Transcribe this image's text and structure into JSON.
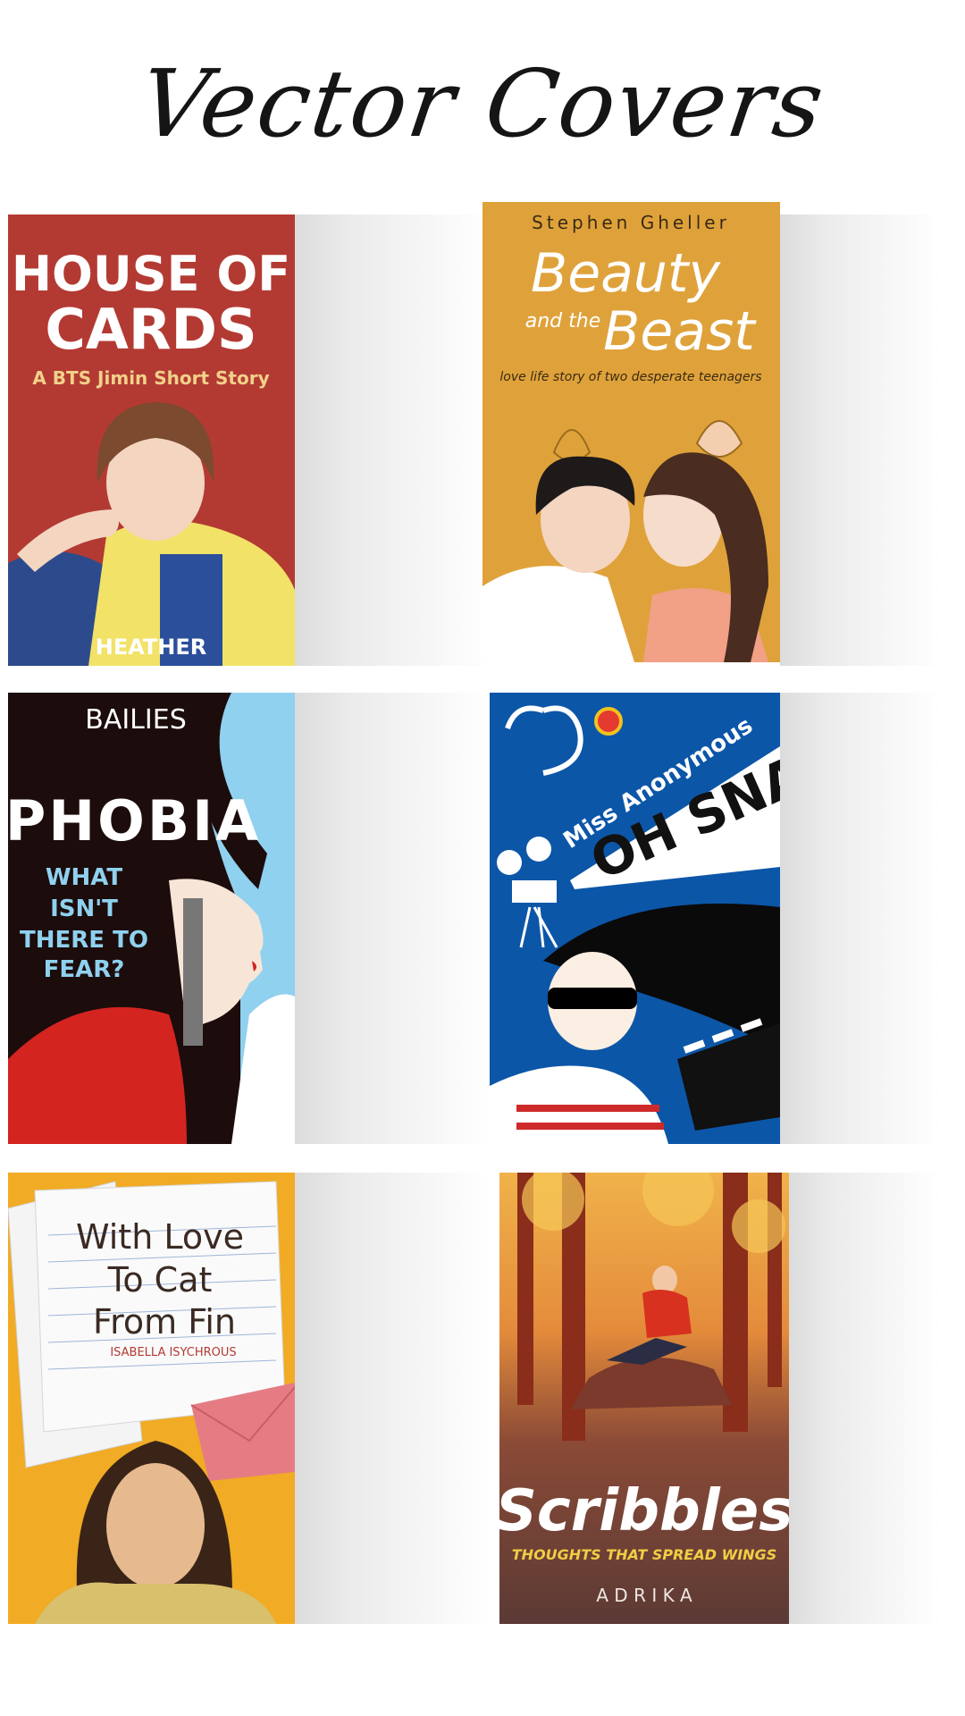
{
  "page": {
    "title": "Vector Covers"
  },
  "covers": [
    {
      "title_line1": "HOUSE OF",
      "title_line2": "CARDS",
      "subtitle": "A BTS Jimin Short Story",
      "author": "HEATHER",
      "colors": {
        "background": "#b33a33",
        "title": "#ffffff",
        "subtitle": "#f1d18a"
      }
    },
    {
      "author": "Stephen Gheller",
      "title_line1": "Beauty",
      "title_line2a": "and the",
      "title_line2b": "Beast",
      "tagline": "love life story of two desperate teenagers",
      "colors": {
        "background": "#dfa23b",
        "title": "#ffffff"
      }
    },
    {
      "author": "BAILIES",
      "title": "PHOBIA",
      "tagline_line1": "WHAT",
      "tagline_line2": "ISN'T",
      "tagline_line3": "THERE TO",
      "tagline_line4": "FEAR?",
      "colors": {
        "background": "#1c0c0c",
        "sky": "#8fd1ee",
        "tagline": "#8fd1ee"
      }
    },
    {
      "author": "Miss Anonymous",
      "title": "OH SNAP",
      "colors": {
        "background": "#0c56a8",
        "banner": "#ffffff"
      }
    },
    {
      "title_line1": "With Love",
      "title_line2": "To Cat",
      "title_line3": "From Fin",
      "author": "ISABELLA ISYCHROUS",
      "colors": {
        "background": "#f1ab24",
        "paper": "#f8f8f8"
      }
    },
    {
      "title": "Scribbles",
      "tagline": "THOUGHTS THAT SPREAD WINGS",
      "author": "A D R I K A",
      "colors": {
        "background": "#6d4335",
        "tagline": "#f2cd45"
      }
    }
  ]
}
